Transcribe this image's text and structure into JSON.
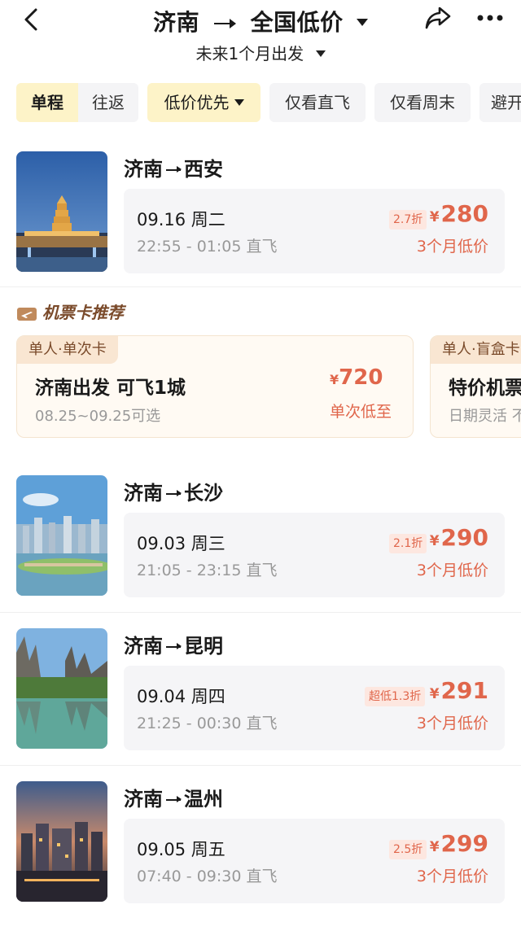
{
  "header": {
    "title": "济南 → 全国低价",
    "from": "济南",
    "to": "全国低价",
    "subtitle": "未来1个月出发"
  },
  "filters": {
    "one_way": "单程",
    "round_trip": "往返",
    "sort": "低价优先",
    "nonstop": "仅看直飞",
    "weekend": "仅看周末",
    "avoid": "避开"
  },
  "routes": [
    {
      "from": "济南",
      "to": "西安",
      "date": "09.16 周二",
      "time": "22:55 - 01:05 直飞",
      "discount": "2.7折",
      "price": "280",
      "note": "3个月低价"
    },
    {
      "from": "济南",
      "to": "长沙",
      "date": "09.03 周三",
      "time": "21:05 - 23:15 直飞",
      "discount": "2.1折",
      "price": "290",
      "note": "3个月低价"
    },
    {
      "from": "济南",
      "to": "昆明",
      "date": "09.04 周四",
      "time": "21:25 - 00:30 直飞",
      "discount": "超低1.3折",
      "price": "291",
      "note": "3个月低价"
    },
    {
      "from": "济南",
      "to": "温州",
      "date": "09.05 周五",
      "time": "07:40 - 09:30 直飞",
      "discount": "2.5折",
      "price": "299",
      "note": "3个月低价"
    }
  ],
  "currency": "¥",
  "ticket_cards": {
    "section_title": "机票卡推荐",
    "cards": [
      {
        "tag": "单人·单次卡",
        "title": "济南出发 可飞1城",
        "sub": "08.25~09.25可选",
        "price": "720",
        "note": "单次低至"
      },
      {
        "tag": "单人·盲盒卡",
        "title": "特价机票",
        "sub": "日期灵活 不"
      }
    ]
  },
  "colors": {
    "accent": "#e0664b",
    "chip_active": "#fdf3c8",
    "brown": "#7a4a2a"
  }
}
